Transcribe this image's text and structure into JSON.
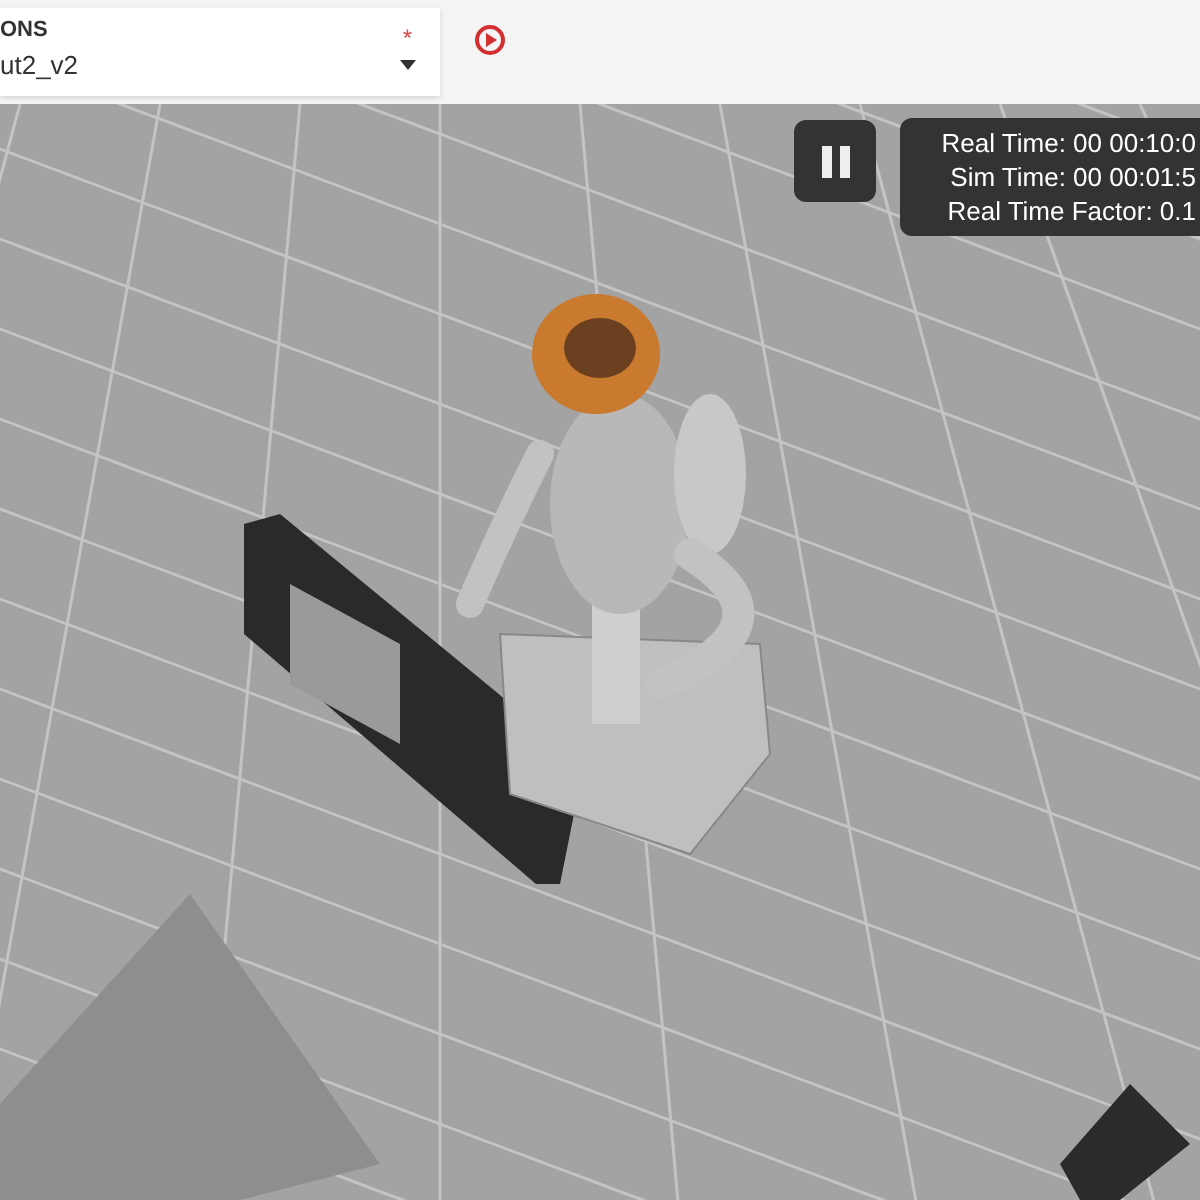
{
  "selector": {
    "label": "ONS",
    "required_mark": "*",
    "value": "ut2_v2"
  },
  "viewport": {
    "paused": false,
    "stats": [
      "Real Time: 00 00:10:0",
      "Sim Time: 00 00:01:5",
      "Real Time Factor: 0.1"
    ]
  }
}
